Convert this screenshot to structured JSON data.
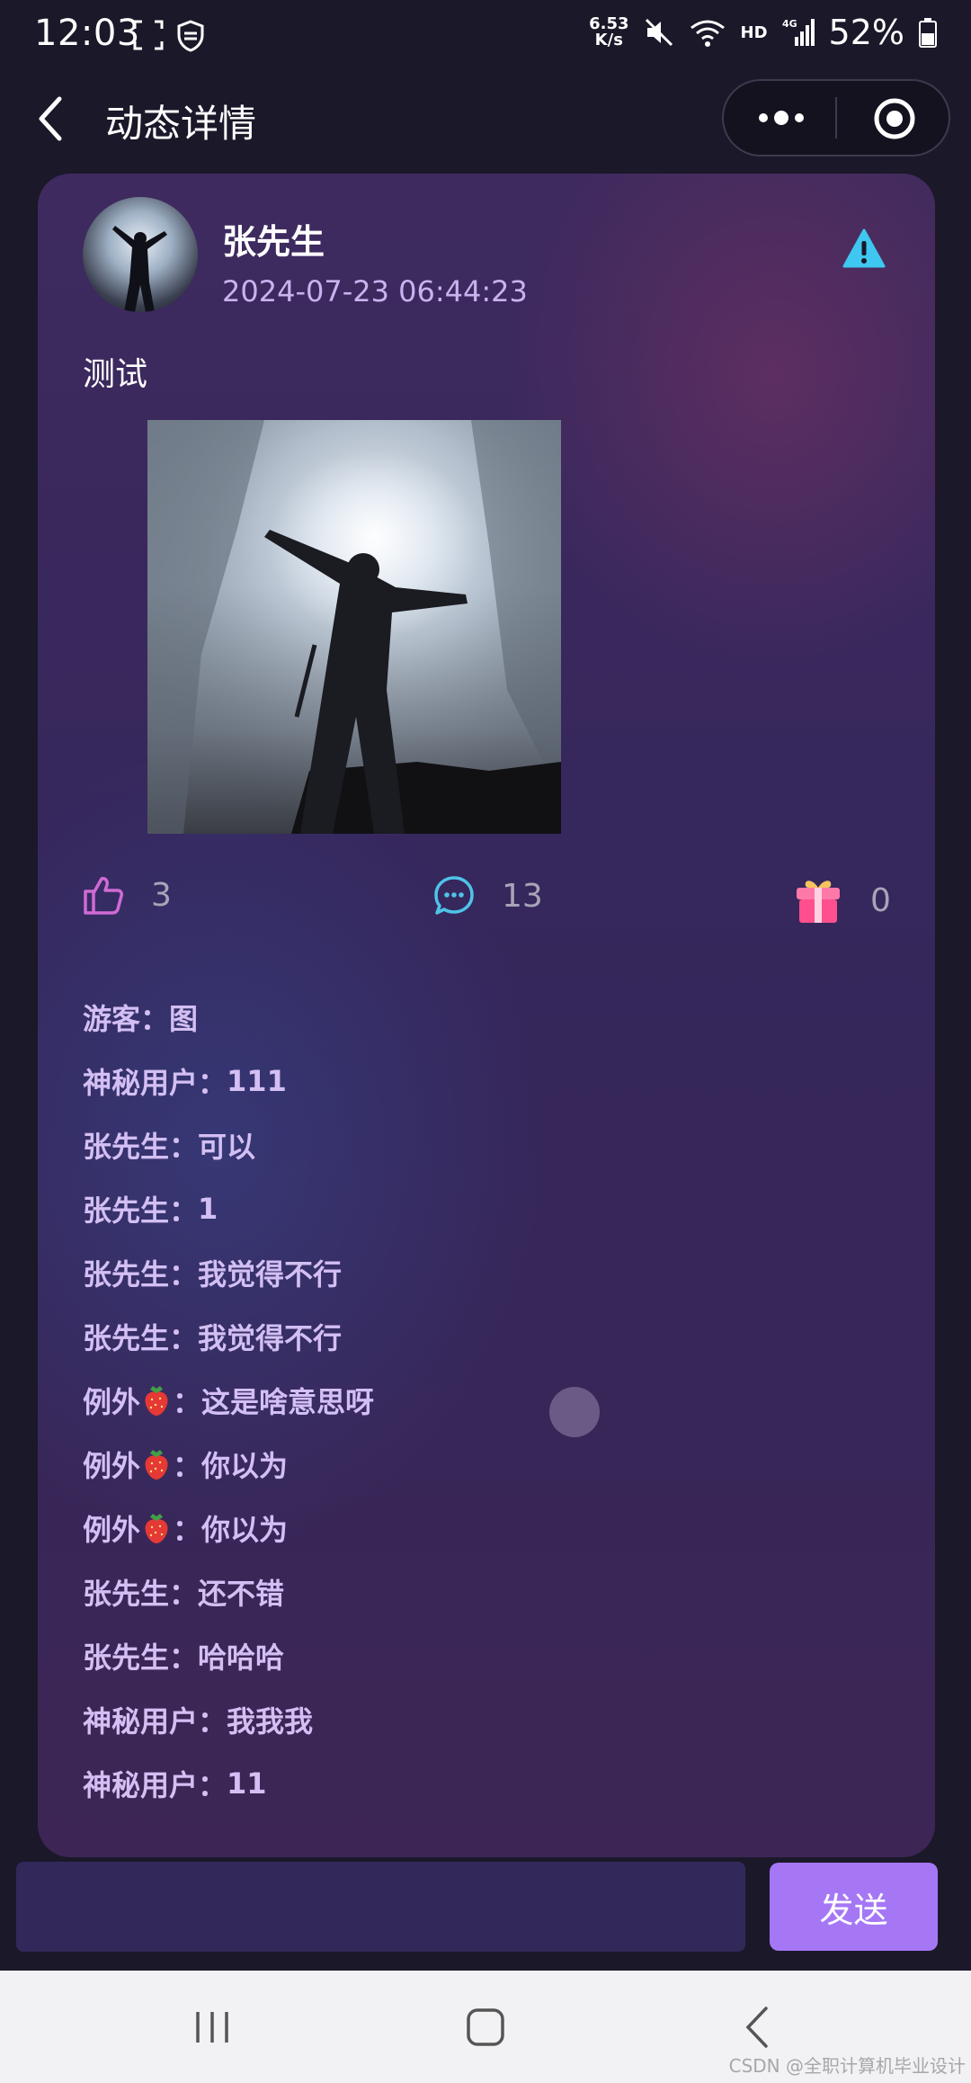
{
  "status_bar": {
    "time": "12:03",
    "net_speed_value": "6.53",
    "net_speed_unit": "K/s",
    "hd": "HD",
    "network": "4G",
    "battery": "52%"
  },
  "nav": {
    "title": "动态详情"
  },
  "post": {
    "author": "张先生",
    "time": "2024-07-23 06:44:23",
    "text": "测试",
    "likes": "3",
    "comments_count": "13",
    "gifts": "0"
  },
  "comments": [
    {
      "name": "游客",
      "sep": "：",
      "text": "图",
      "emoji": false
    },
    {
      "name": "神秘用户",
      "sep": "：",
      "text": "111",
      "emoji": false
    },
    {
      "name": "张先生",
      "sep": "：",
      "text": "可以",
      "emoji": false
    },
    {
      "name": "张先生",
      "sep": "：",
      "text": "1",
      "emoji": false
    },
    {
      "name": "张先生",
      "sep": "：",
      "text": "我觉得不行",
      "emoji": false
    },
    {
      "name": "张先生",
      "sep": "：",
      "text": "我觉得不行",
      "emoji": false
    },
    {
      "name": "例外",
      "sep": "：",
      "text": "这是啥意思呀",
      "emoji": true
    },
    {
      "name": "例外",
      "sep": "：",
      "text": "你以为",
      "emoji": true
    },
    {
      "name": "例外",
      "sep": "：",
      "text": "你以为",
      "emoji": true
    },
    {
      "name": "张先生",
      "sep": "：",
      "text": "还不错",
      "emoji": false
    },
    {
      "name": "张先生",
      "sep": "：",
      "text": "哈哈哈",
      "emoji": false
    },
    {
      "name": "神秘用户",
      "sep": "：",
      "text": "我我我",
      "emoji": false
    },
    {
      "name": "神秘用户",
      "sep": "：",
      "text": "11",
      "emoji": false
    }
  ],
  "input": {
    "placeholder": "",
    "send_label": "发送"
  },
  "watermark": "CSDN @全职计算机毕业设计",
  "colors": {
    "accent": "#a577f5",
    "comment_text": "#d3bff3",
    "like_icon": "#d06ad6",
    "comment_icon": "#4fc3e8",
    "warning_icon": "#3ec7f0"
  }
}
